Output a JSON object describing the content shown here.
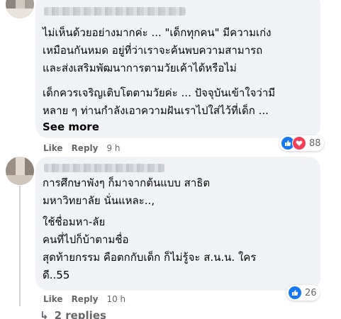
{
  "comment1": {
    "lines": [
      "ไม่เห็นด้วยอย่างมากค่ะ ... \"เด็กทุกคน\" มีความเก่ง",
      "เหมือนกันหมด อยู่ที่ว่าเราจะค้นพบความสามารถ",
      "และส่งเสริมพัฒนาการตามวัยเค้าได้หรือไม่",
      "เด็กควรเจริญเติบโตตามวัยค่ะ ... ปัจจุบันเข้าใจว่ามี",
      "หลาย ๆ ท่านกำลังเอาความฝันเราไปใส่ไว้ที่เด็ก ..."
    ],
    "see_more": "See more",
    "like": "Like",
    "reply": "Reply",
    "time": "9 h",
    "reaction_count": "88",
    "reaction_icons": [
      "like-icon",
      "love-icon"
    ]
  },
  "comment2": {
    "lines": [
      "การศึกษาพังๆ ก็มาจากต้นแบบ สาธิต",
      "มหาวิทยาลัย นั่นแหละ..,",
      "ใช้ชื่อมหา-ลัย",
      "คนที่ไปก็บ้าตามชื่อ",
      "สุดท้ายกรรม คือตกกับเด็ก ก็ไม่รู้จะ ส.น.น. ใคร",
      "ดี..55"
    ],
    "like": "Like",
    "reply": "Reply",
    "time": "10 h",
    "reaction_count": "26",
    "reaction_icons": [
      "like-icon"
    ]
  },
  "replies_link": "2 replies",
  "colors": {
    "bubble": "#f0f2f5",
    "meta_text": "#65676b",
    "like_blue": "#1877f2",
    "love_red": "#f33e58"
  }
}
